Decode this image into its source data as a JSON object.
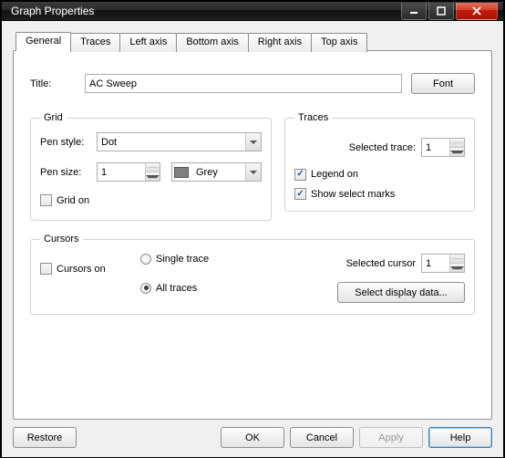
{
  "window": {
    "title": "Graph Properties"
  },
  "tabs": {
    "general": "General",
    "traces": "Traces",
    "left_axis": "Left axis",
    "bottom_axis": "Bottom axis",
    "right_axis": "Right axis",
    "top_axis": "Top axis"
  },
  "title_row": {
    "label": "Title:",
    "value": "AC Sweep",
    "font_btn": "Font"
  },
  "grid": {
    "legend": "Grid",
    "pen_style_label": "Pen style:",
    "pen_style_value": "Dot",
    "pen_size_label": "Pen size:",
    "pen_size_value": "1",
    "pen_color_value": "Grey",
    "pen_color_swatch": "#808080",
    "grid_on_label": "Grid on",
    "grid_on_checked": false
  },
  "traces_box": {
    "legend": "Traces",
    "selected_trace_label": "Selected trace:",
    "selected_trace_value": "1",
    "legend_on_label": "Legend on",
    "legend_on_checked": true,
    "show_marks_label": "Show select marks",
    "show_marks_checked": true
  },
  "cursors_box": {
    "legend": "Cursors",
    "cursors_on_label": "Cursors on",
    "cursors_on_checked": false,
    "single_trace_label": "Single trace",
    "all_traces_label": "All traces",
    "mode_selected": "all",
    "selected_cursor_label": "Selected cursor",
    "selected_cursor_value": "1",
    "select_display_btn": "Select display data..."
  },
  "buttons": {
    "restore": "Restore",
    "ok": "OK",
    "cancel": "Cancel",
    "apply": "Apply",
    "help": "Help"
  }
}
